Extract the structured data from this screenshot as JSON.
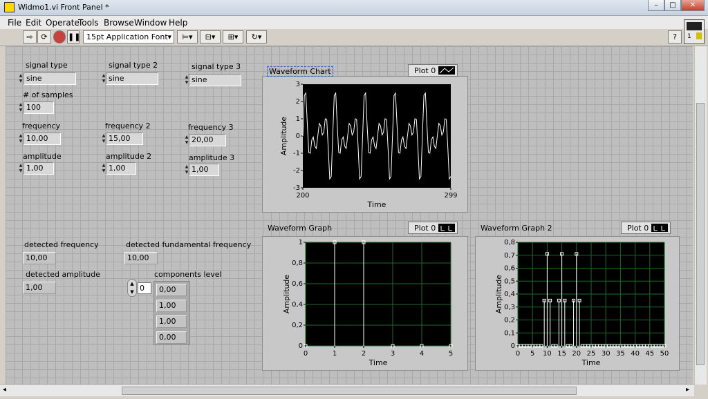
{
  "window": {
    "title": "Widmo1.vi Front Panel *"
  },
  "menu": [
    "File",
    "Edit",
    "Operate",
    "Tools",
    "Browse",
    "Window",
    "Help"
  ],
  "toolbar": {
    "font": "15pt Application Font"
  },
  "controls": {
    "signal_type_label": "signal type",
    "signal_type": "sine",
    "signal_type2_label": "signal type 2",
    "signal_type2": "sine",
    "signal_type3_label": "signal type 3",
    "signal_type3": "sine",
    "samples_label": "# of samples",
    "samples": "100",
    "freq_label": "frequency",
    "freq": "10,00",
    "freq2_label": "frequency 2",
    "freq2": "15,00",
    "freq3_label": "frequency 3",
    "freq3": "20,00",
    "amp_label": "amplitude",
    "amp": "1,00",
    "amp2_label": "amplitude 2",
    "amp2": "1,00",
    "amp3_label": "amplitude 3",
    "amp3": "1,00"
  },
  "indicators": {
    "det_freq_label": "detected frequency",
    "det_freq": "10,00",
    "det_fund_label": "detected fundamental frequency",
    "det_fund": "10,00",
    "det_amp_label": "detected amplitude",
    "det_amp": "1,00",
    "comp_label": "components level",
    "comp_index": "0",
    "components": [
      "0,00",
      "1,00",
      "1,00",
      "0,00"
    ]
  },
  "colors": {
    "plot_bg": "#000000",
    "grid": "#1b6a2a",
    "trace": "#ffffff"
  },
  "chart_data": [
    {
      "type": "line",
      "title": "Waveform Chart",
      "legend": "Plot 0",
      "xlabel": "Time",
      "ylabel": "Amplitude",
      "xlim": [
        200,
        299
      ],
      "ylim": [
        -3,
        3
      ],
      "yticks": [
        "3",
        "2",
        "1",
        "0",
        "-1",
        "-2",
        "-3"
      ],
      "xticks": [
        "200",
        "299"
      ],
      "samples": 100,
      "components": [
        {
          "frequency": 10,
          "amplitude": 1
        },
        {
          "frequency": 15,
          "amplitude": 1
        },
        {
          "frequency": 20,
          "amplitude": 1
        }
      ]
    },
    {
      "type": "bar",
      "title": "Waveform Graph",
      "legend": "Plot 0",
      "xlabel": "Time",
      "ylabel": "Amplitude",
      "xlim": [
        0,
        5
      ],
      "ylim": [
        0,
        1
      ],
      "grid": true,
      "xticks": [
        "0",
        "1",
        "2",
        "3",
        "4",
        "5"
      ],
      "yticks": [
        "1",
        "0,8",
        "0,6",
        "0,4",
        "0,2",
        "0"
      ],
      "x": [
        0,
        1,
        2,
        3,
        4,
        5
      ],
      "values": [
        0,
        1,
        1,
        0,
        0,
        0
      ]
    },
    {
      "type": "bar",
      "title": "Waveform Graph 2",
      "legend": "Plot 0",
      "xlabel": "Time",
      "ylabel": "Amplitude",
      "xlim": [
        0,
        50
      ],
      "ylim": [
        0,
        0.8
      ],
      "grid": true,
      "xticks": [
        "0",
        "5",
        "10",
        "15",
        "20",
        "25",
        "30",
        "35",
        "40",
        "45",
        "50"
      ],
      "yticks": [
        "0,8",
        "0,7",
        "0,6",
        "0,5",
        "0,4",
        "0,3",
        "0,2",
        "0,1",
        "0"
      ],
      "x": [
        0,
        1,
        2,
        3,
        4,
        5,
        6,
        7,
        8,
        9,
        10,
        11,
        12,
        13,
        14,
        15,
        16,
        17,
        18,
        19,
        20,
        21,
        22,
        23,
        24,
        25,
        26,
        27,
        28,
        29,
        30,
        31,
        32,
        33,
        34,
        35,
        36,
        37,
        38,
        39,
        40,
        41,
        42,
        43,
        44,
        45,
        46,
        47,
        48,
        49,
        50
      ],
      "values": [
        0,
        0,
        0,
        0,
        0,
        0,
        0,
        0,
        0,
        0.35,
        0.71,
        0.35,
        0,
        0,
        0.35,
        0.71,
        0.35,
        0,
        0,
        0.35,
        0.71,
        0.35,
        0,
        0,
        0,
        0,
        0,
        0,
        0,
        0,
        0,
        0,
        0,
        0,
        0,
        0,
        0,
        0,
        0,
        0,
        0,
        0,
        0,
        0,
        0,
        0,
        0,
        0,
        0,
        0,
        0
      ]
    }
  ]
}
